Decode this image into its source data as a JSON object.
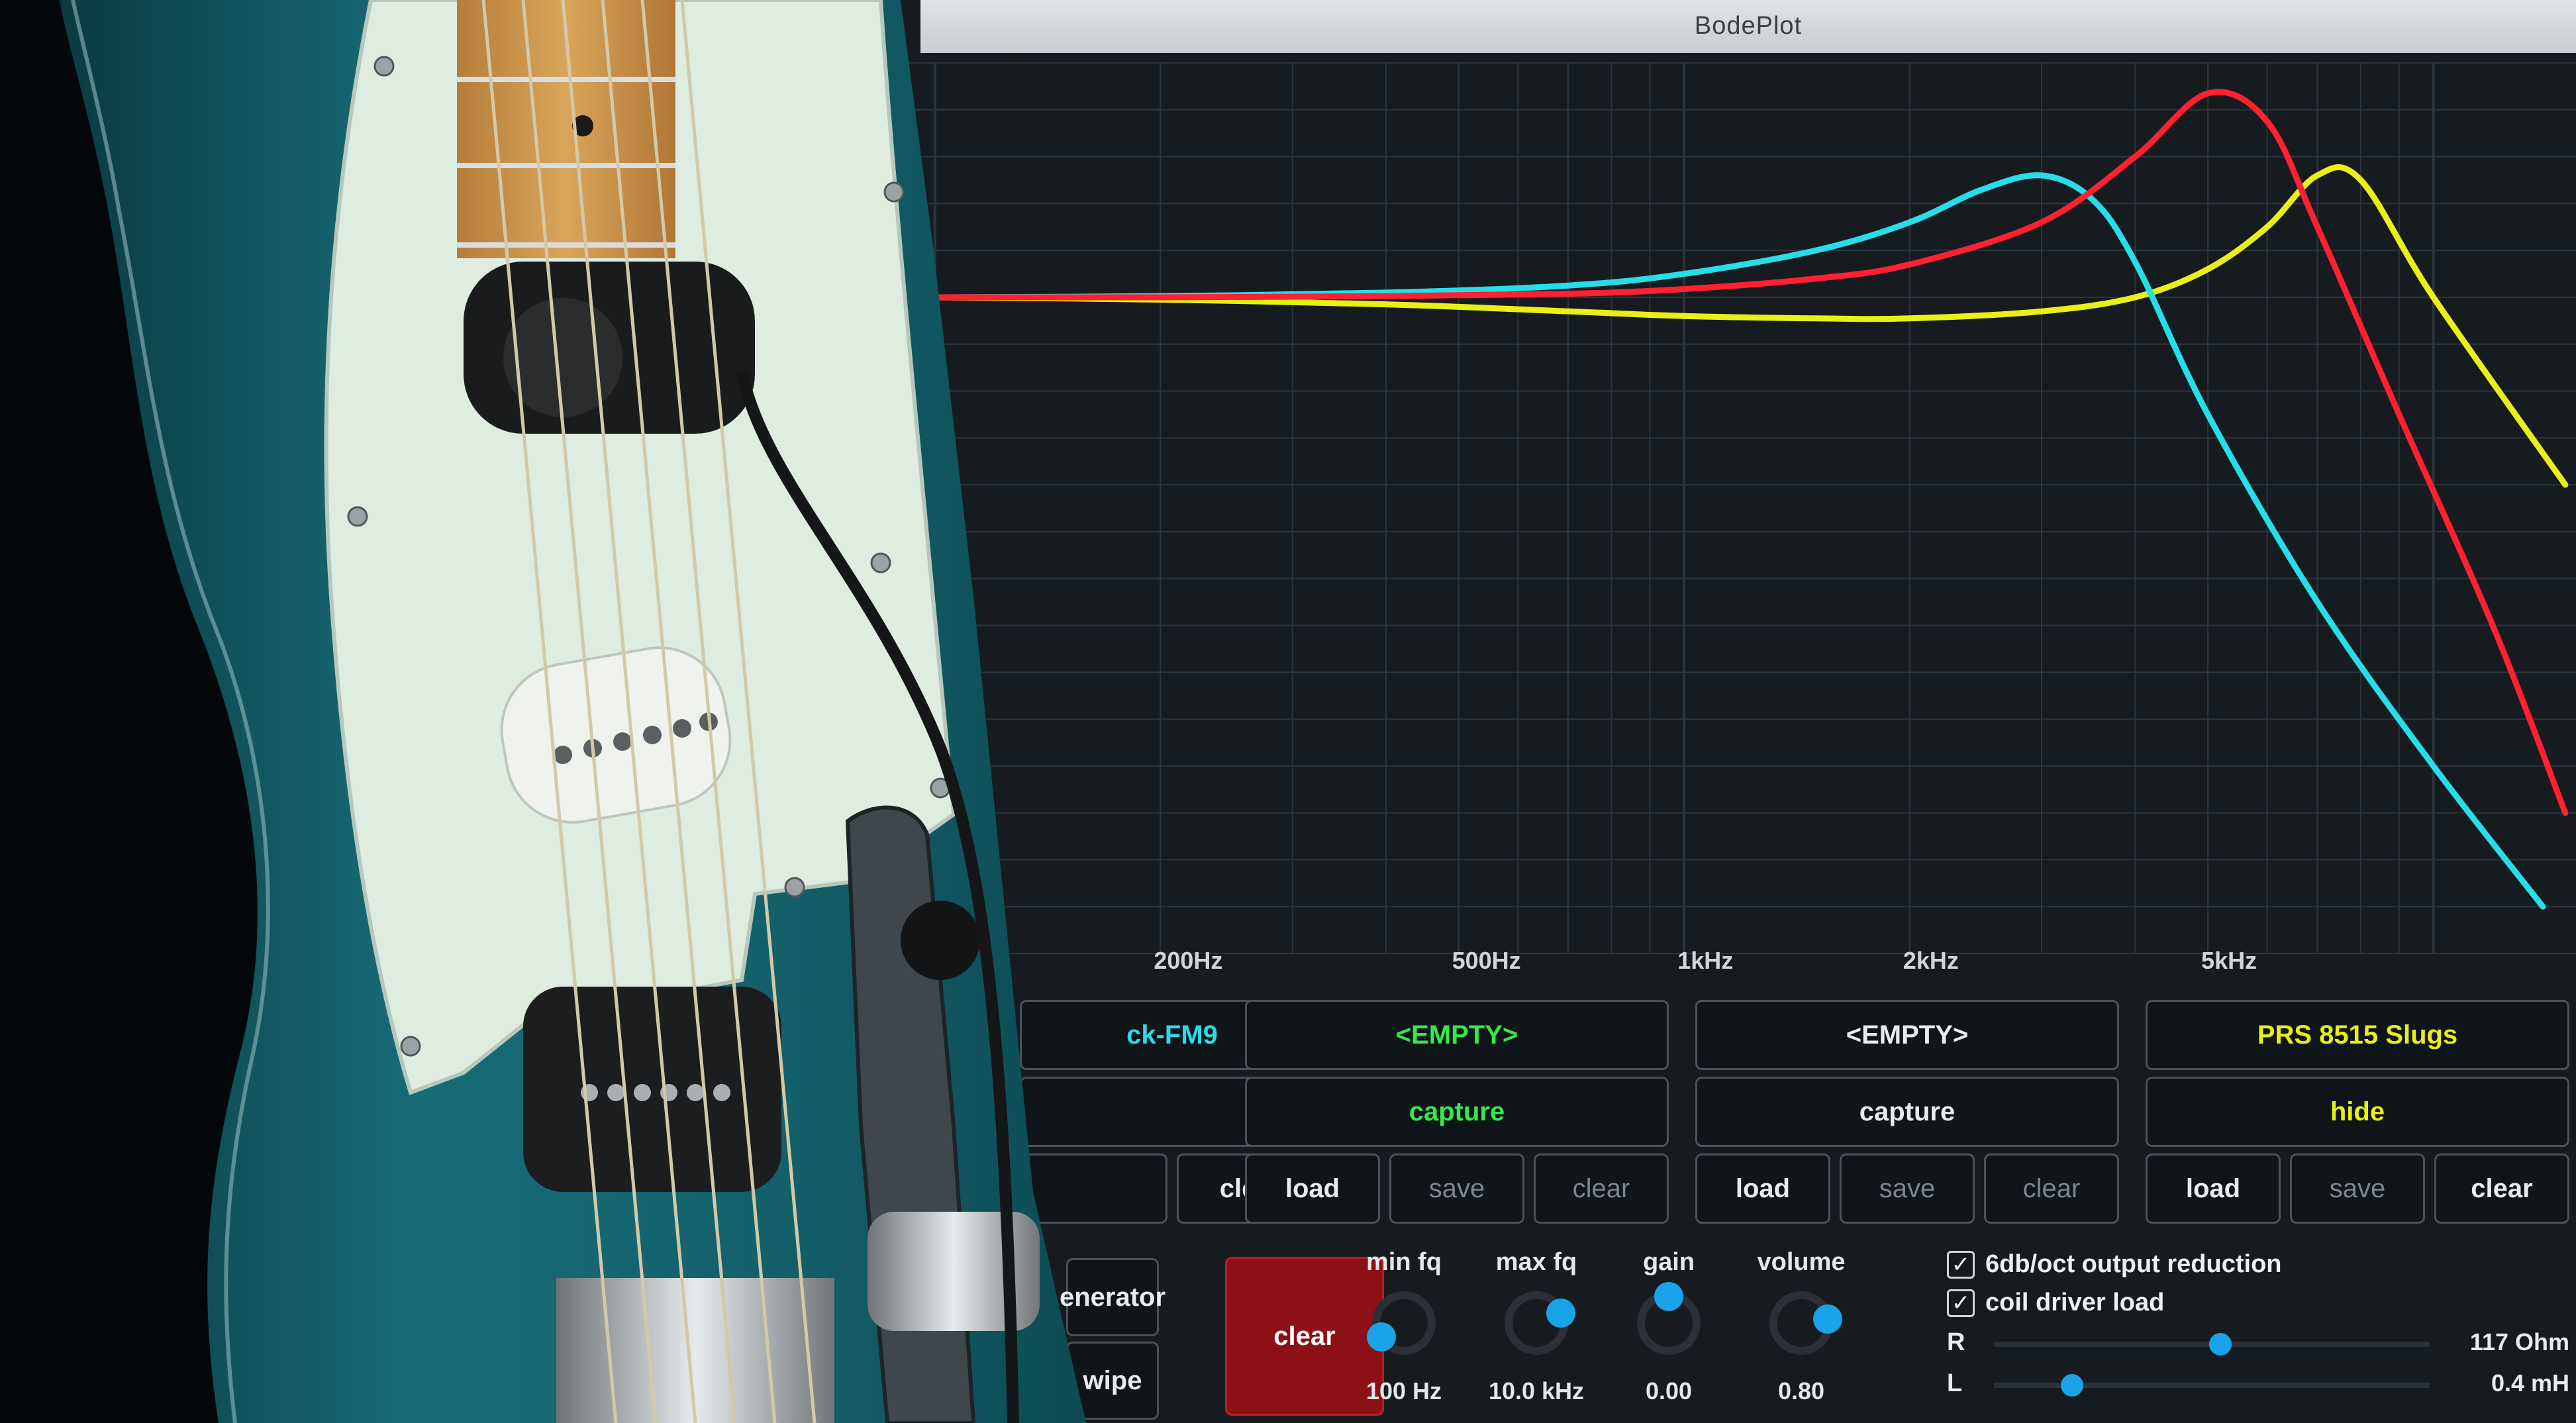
{
  "window": {
    "title": "BodePlot"
  },
  "colors": {
    "background": "#161b20",
    "grid": "#2c353b",
    "series_cyan": "#27dde8",
    "series_red": "#ff2030",
    "series_yellow": "#e8f016",
    "accent_blue": "#1aa3e8",
    "clear_button": "#8c1016",
    "guitar_body": "#13606b",
    "pickguard": "#dfece0"
  },
  "chart_data": {
    "type": "line",
    "x_scale": "log",
    "x_ticks": [
      "200Hz",
      "500Hz",
      "1kHz",
      "2kHz",
      "5kHz"
    ],
    "grid": true,
    "series": [
      {
        "color": "cyan",
        "x": [
          100,
          200,
          400,
          700,
          1000,
          1500,
          2000,
          2500,
          3000,
          3500,
          4000,
          5000,
          7000,
          10000,
          14000
        ],
        "y": [
          0,
          0.05,
          0.2,
          0.5,
          1.0,
          2.0,
          3.2,
          4.6,
          5.2,
          4.2,
          1.5,
          -5,
          -13,
          -20,
          -26
        ]
      },
      {
        "color": "red",
        "x": [
          100,
          200,
          400,
          700,
          1000,
          1500,
          2000,
          3000,
          4000,
          5000,
          6000,
          7000,
          9000,
          12000,
          15000
        ],
        "y": [
          0,
          0,
          0.05,
          0.15,
          0.35,
          0.8,
          1.4,
          3.2,
          6.0,
          8.7,
          7.5,
          3,
          -5,
          -14,
          -22
        ]
      },
      {
        "color": "yellow",
        "x": [
          100,
          200,
          400,
          700,
          1000,
          1500,
          2000,
          3000,
          4000,
          5000,
          6000,
          7000,
          8000,
          10000,
          15000
        ],
        "y": [
          0,
          -0.1,
          -0.3,
          -0.6,
          -0.8,
          -0.9,
          -0.9,
          -0.6,
          0,
          1.2,
          3,
          5.2,
          5.0,
          0,
          -8
        ]
      }
    ],
    "x_range": [
      90,
      15500
    ],
    "y_range": [
      -28,
      10
    ]
  },
  "slots": [
    {
      "name": "ck-FM9",
      "name_color": "cyan",
      "action": "",
      "buttons": [
        "",
        "clear"
      ]
    },
    {
      "name": "<EMPTY>",
      "name_color": "green",
      "action": "capture",
      "action_color": "green",
      "buttons": [
        "load",
        "save",
        "clear"
      ]
    },
    {
      "name": "<EMPTY>",
      "name_color": "white",
      "action": "capture",
      "action_color": "white",
      "buttons": [
        "load",
        "save",
        "clear"
      ]
    },
    {
      "name": "PRS 8515 Slugs",
      "name_color": "yellow",
      "action": "hide",
      "action_color": "yellow",
      "buttons": [
        "load",
        "save",
        "clear"
      ]
    }
  ],
  "left_buttons": {
    "generator": "enerator",
    "wipe": "wipe"
  },
  "clear_big": "clear",
  "knobs": [
    {
      "label": "min fq",
      "value": "100 Hz",
      "level": 0.05
    },
    {
      "label": "max fq",
      "value": "10.0 kHz",
      "level": 0.75
    },
    {
      "label": "gain",
      "value": "0.00",
      "level": 0.5
    },
    {
      "label": "volume",
      "value": "0.80",
      "level": 0.8
    }
  ],
  "options": [
    {
      "label": "6db/oct output reduction",
      "checked": true
    },
    {
      "label": "coil driver load",
      "checked": true
    }
  ],
  "sliders": [
    {
      "label": "R",
      "value": "117 Ohm",
      "level": 0.52
    },
    {
      "label": "L",
      "value": "0.4 mH",
      "level": 0.18
    }
  ],
  "check_glyph": "✓"
}
